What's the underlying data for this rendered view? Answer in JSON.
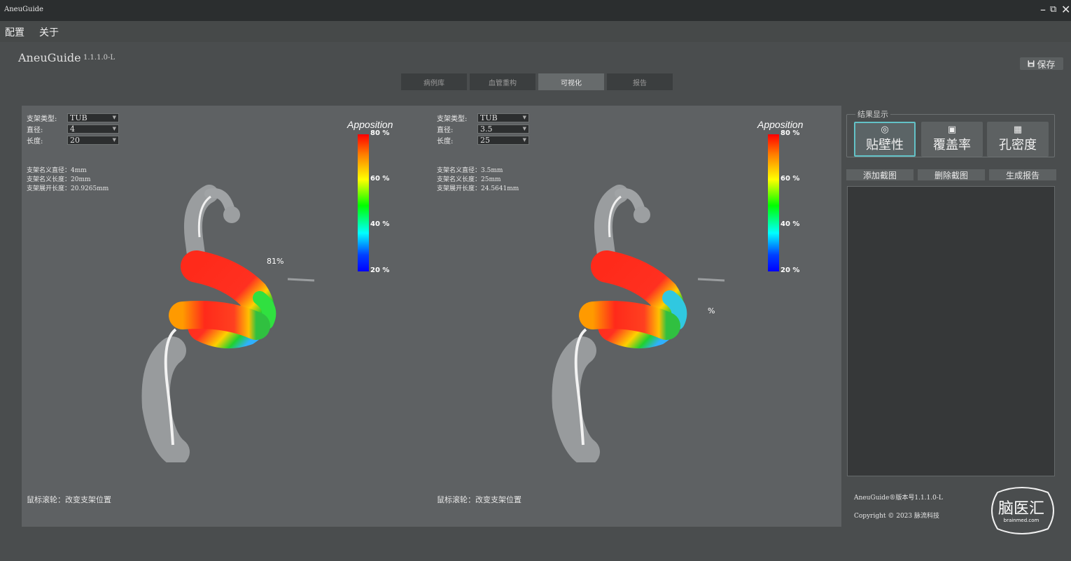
{
  "window": {
    "title": "AneuGuide",
    "controls": [
      "–",
      "⧉",
      "✕"
    ]
  },
  "menu": [
    "配置",
    "关于"
  ],
  "app": {
    "name": "AneuGuide",
    "version": "1.1.1.0-L"
  },
  "save_label": "保存",
  "tabs": [
    "病例库",
    "血管重构",
    "可视化",
    "报告"
  ],
  "active_tab": 2,
  "panes": [
    {
      "params": [
        {
          "label": "支架类型:",
          "value": "TUB"
        },
        {
          "label": "直径:",
          "value": "4"
        },
        {
          "label": "长度:",
          "value": "20"
        }
      ],
      "stats": [
        "支架名义直径：4mm",
        "支架名义长度：20mm",
        "支架展开长度：20.9265mm"
      ],
      "percent_label": "81%",
      "hint": "鼠标滚轮：改变支架位置"
    },
    {
      "params": [
        {
          "label": "支架类型:",
          "value": "TUB"
        },
        {
          "label": "直径:",
          "value": "3.5"
        },
        {
          "label": "长度:",
          "value": "25"
        }
      ],
      "stats": [
        "支架名义直径：3.5mm",
        "支架名义长度：25mm",
        "支架展开长度：24.5641mm"
      ],
      "percent_label": "%",
      "hint": "鼠标滚轮：改变支架位置"
    }
  ],
  "legend": {
    "title": "Apposition",
    "ticks": [
      "80 %",
      "60 %",
      "40 %",
      "20 %"
    ]
  },
  "result": {
    "title": "结果显示",
    "buttons": [
      {
        "label": "贴壁性",
        "icon": "target-icon"
      },
      {
        "label": "覆盖率",
        "icon": "image-frame-icon"
      },
      {
        "label": "孔密度",
        "icon": "grid-icon"
      }
    ],
    "active": 0
  },
  "actions": [
    "添加截图",
    "删除截图",
    "生成报告"
  ],
  "footer": {
    "line1": "AneuGuide®版本号1.1.1.0-L",
    "line2": "Copyright © 2023 脉流科技"
  },
  "watermark": {
    "text": "脑医汇",
    "sub": "brainmed.com"
  },
  "colors": {
    "active_border": "#63c2c7",
    "background": "#4a4d4e",
    "viewport": "#5e6163"
  }
}
